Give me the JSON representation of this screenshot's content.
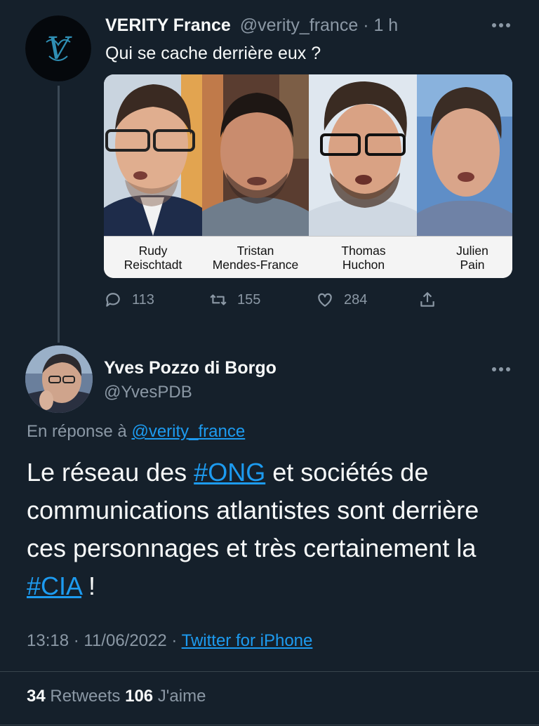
{
  "tweet1": {
    "author_name": "VERITY France",
    "handle": "@verity_france",
    "time": "· 1 h",
    "text": "Qui se cache derrière eux ?",
    "media": {
      "captions": [
        {
          "line1": "Rudy",
          "line2": "Reischtadt"
        },
        {
          "line1": "Tristan",
          "line2": "Mendes-France"
        },
        {
          "line1": "Thomas",
          "line2": "Huchon"
        },
        {
          "line1": "Julien",
          "line2": "Pain"
        }
      ]
    },
    "actions": {
      "replies": "113",
      "retweets": "155",
      "likes": "284"
    }
  },
  "tweet2": {
    "author_name": "Yves Pozzo di Borgo",
    "handle": "@YvesPDB",
    "reply_prefix": "En réponse à",
    "reply_to": "@verity_france",
    "text_part1": "Le réseau des ",
    "hashtag1": "#ONG",
    "text_part2": " et sociétés de communications atlantistes sont derrière ces personnages et très certainement la ",
    "hashtag2": "#CIA",
    "text_part3": " !",
    "time": "13:18 · 11/06/2022 ·",
    "source": "Twitter for iPhone",
    "retweets_count": "34",
    "retweets_label": " Retweets ",
    "likes_count": "106",
    "likes_label": " J'aime"
  },
  "colors": {
    "background": "#15202b",
    "accent": "#1d9bf0",
    "secondary_text": "#8b98a5"
  },
  "icons": [
    "more-icon",
    "reply-icon",
    "retweet-icon",
    "like-icon",
    "share-icon"
  ]
}
